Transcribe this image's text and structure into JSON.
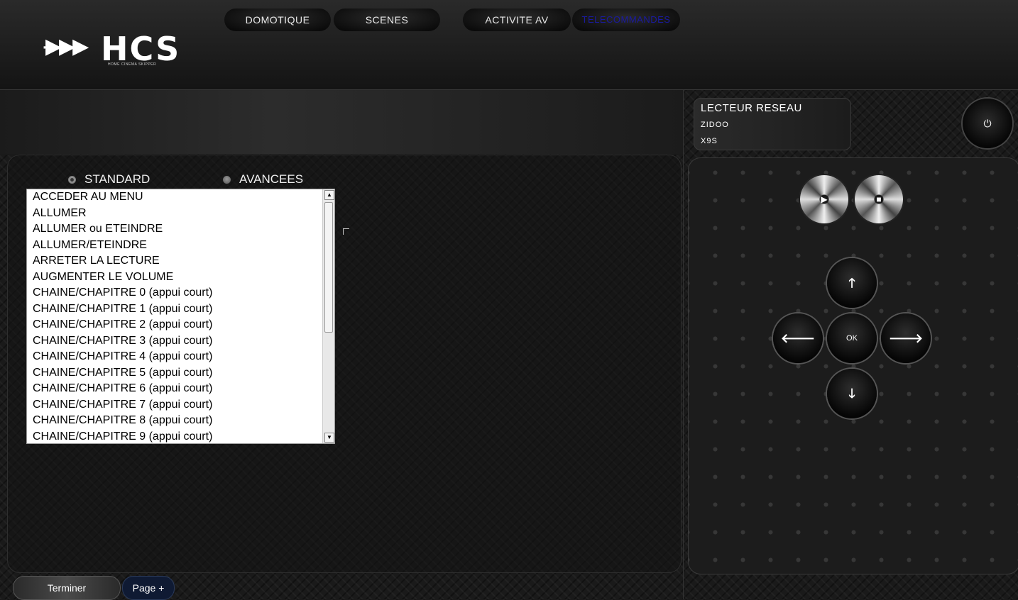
{
  "header": {
    "logo_mark": "·▶▶▶",
    "logo_text": "HCS",
    "logo_subtitle": "HOME CINEMA SKIPPER",
    "tabs": [
      {
        "label": "DOMOTIQUE",
        "active": false
      },
      {
        "label": "SCENES",
        "active": false
      },
      {
        "label": "ACTIVITE AV",
        "active": false
      },
      {
        "label": "TELECOMMANDES",
        "active": true
      }
    ]
  },
  "mode": {
    "standard_label": "STANDARD",
    "advanced_label": "AVANCEES",
    "selected": "STANDARD"
  },
  "commands": [
    "ACCEDER AU MENU",
    "ALLUMER",
    "ALLUMER ou ETEINDRE",
    "ALLUMER/ETEINDRE",
    "ARRETER LA LECTURE",
    "AUGMENTER LE VOLUME",
    "CHAINE/CHAPITRE 0 (appui court)",
    "CHAINE/CHAPITRE 1 (appui court)",
    "CHAINE/CHAPITRE 2 (appui court)",
    "CHAINE/CHAPITRE 3 (appui court)",
    "CHAINE/CHAPITRE 4 (appui court)",
    "CHAINE/CHAPITRE 5 (appui court)",
    "CHAINE/CHAPITRE 6 (appui court)",
    "CHAINE/CHAPITRE 7 (appui court)",
    "CHAINE/CHAPITRE 8 (appui court)",
    "CHAINE/CHAPITRE 9 (appui court)"
  ],
  "device": {
    "title": "LECTEUR RESEAU",
    "brand": "ZIDOO",
    "model": "X9S"
  },
  "remote": {
    "power_icon": "⏻",
    "play_icon": "▶",
    "stop_icon": "■",
    "up_icon": "🡑",
    "down_icon": "🡓",
    "left_icon": "🡐",
    "right_icon": "🡒",
    "ok_label": "OK"
  },
  "footer": {
    "finish_label": "Terminer",
    "page_label": "Page +"
  },
  "colors": {
    "active_tab": "#1a1aa0",
    "page_button": "#0f1a33"
  }
}
